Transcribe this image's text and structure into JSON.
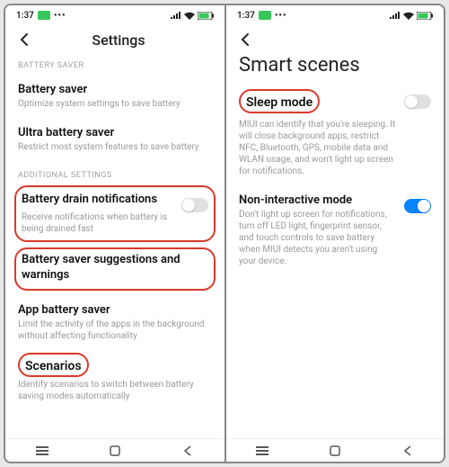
{
  "status": {
    "time": "1:37",
    "dots": "•••"
  },
  "left": {
    "header_title": "Settings",
    "section1_label": "BATTERY SAVER",
    "battery_saver": {
      "title": "Battery saver",
      "sub": "Optimize system settings to save battery"
    },
    "ultra_battery_saver": {
      "title": "Ultra battery saver",
      "sub": "Restrict most system features to save battery"
    },
    "section2_label": "ADDITIONAL SETTINGS",
    "drain_notifications": {
      "title": "Battery drain notifications",
      "sub": "Receive notifications when battery is being drained fast"
    },
    "suggestions": {
      "title": "Battery saver suggestions and warnings"
    },
    "app_battery_saver": {
      "title": "App battery saver",
      "sub": "Limit the activity of the apps in the background without affecting functionality"
    },
    "scenarios": {
      "title": "Scenarios",
      "sub": "Identify scenarios to switch between battery saving modes automatically"
    }
  },
  "right": {
    "big_title": "Smart scenes",
    "sleep_mode": {
      "title": "Sleep mode",
      "sub": "MIUI can identify that you're sleeping. It will close background apps, restrict NFC, Bluetooth, GPS, mobile data and WLAN usage, and won't light up screen for notifications."
    },
    "non_interactive": {
      "title": "Non-interactive mode",
      "sub": "Don't light up screen for notifications, turn off LED light, fingerprint sensor, and touch controls to save battery when MIUI detects you aren't using your device."
    }
  }
}
